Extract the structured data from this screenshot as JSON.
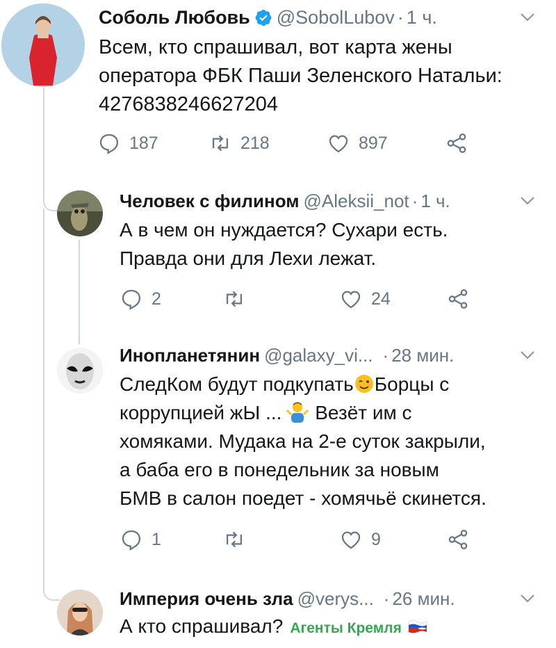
{
  "colors": {
    "text": "#14171a",
    "secondary": "#657786",
    "verified": "#1da1f2",
    "thread_line": "#cfd9de",
    "badge": "#34a853"
  },
  "tweets": [
    {
      "name": "Соболь Любовь",
      "handle": "@SobolLubov",
      "sep": "·",
      "time": "1 ч.",
      "verified": true,
      "lines": [
        "Всем, кто спрашивал, вот карта жены",
        "оператора ФБК Паши Зеленского Натальи:",
        "4276838246627204"
      ],
      "replies": "187",
      "retweets": "218",
      "likes": "897"
    },
    {
      "name": "Человек с филином",
      "handle": "@Aleksii_not",
      "sep": "·",
      "time": "1 ч.",
      "lines": [
        "А в чем он нуждается? Сухари есть.",
        "Правда они для Лехи лежат."
      ],
      "replies": "2",
      "retweets": "",
      "likes": "24"
    },
    {
      "name": "Инопланетянин",
      "handle": "@galaxy_vi...",
      "sep": "·",
      "time": "28 мин.",
      "line1_a": "СледКом будут подкупать",
      "line1_b": "Борцы с",
      "line2_a": "коррупцией жЫ ...",
      "line2_b": " Везёт им с",
      "lines": [
        "хомяками. Мудака на 2-е суток закрыли,",
        "а баба его в  понедельник за  новым",
        "БМВ  в салон поедет - хомячьё скинется."
      ],
      "emoji_1": "winking-face-emoji",
      "emoji_2": "man-shrugging-emoji",
      "replies": "1",
      "retweets": "",
      "likes": "9"
    },
    {
      "name": "Империя очень зла",
      "handle": "@verys...",
      "sep": "·",
      "time": "26 мин.",
      "text": "А кто спрашивал?",
      "badge": "Агенты Кремля",
      "badge_flag": "russian-flag-icon"
    }
  ]
}
